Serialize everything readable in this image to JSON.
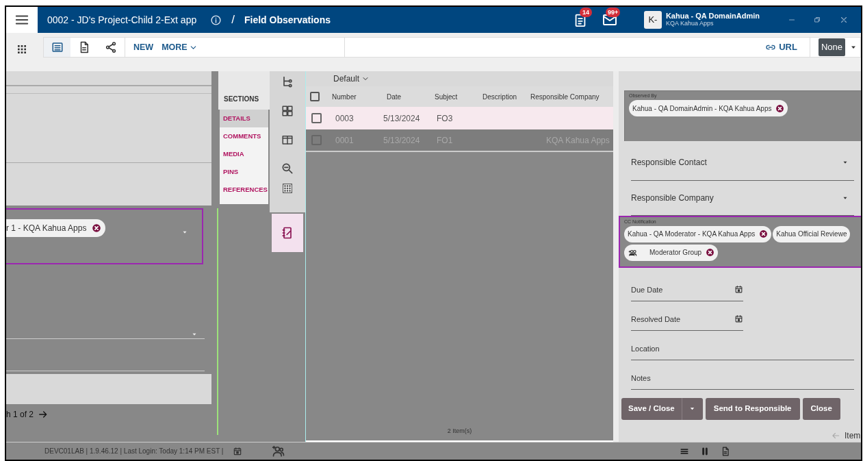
{
  "header": {
    "title": "0002 - JD's Project-Child 2-Ext app",
    "separator": "/",
    "page": "Field Observations",
    "tasks_badge": "14",
    "mail_badge": "99+",
    "avatar": "K-",
    "user_name": "Kahua - QA DomainAdmin",
    "user_org": "KQA Kahua Apps"
  },
  "toolbar": {
    "views": [
      {
        "kind": "list",
        "selected": true
      },
      {
        "kind": "document",
        "selected": false
      },
      {
        "kind": "share",
        "selected": false
      }
    ],
    "actions": [
      "NEW",
      "MORE"
    ],
    "url_label": "URL",
    "select_value": "None"
  },
  "left_panel": {
    "chip": "r 1 - KQA Kahua Apps",
    "pager": "h 1 of 2"
  },
  "sections": {
    "title": "SECTIONS",
    "items": [
      {
        "label": "DETAILS",
        "selected": true
      },
      {
        "label": "COMMENTS",
        "selected": false
      },
      {
        "label": "MEDIA",
        "selected": false
      },
      {
        "label": "PINS",
        "selected": false
      },
      {
        "label": "REFERENCES",
        "selected": false
      }
    ]
  },
  "list": {
    "view": "Default",
    "columns": [
      "Number",
      "Date",
      "Subject",
      "Description",
      "Responsible Company"
    ],
    "rows": [
      {
        "number": "0003",
        "date": "5/13/2024",
        "subject": "FO3",
        "company": "",
        "selected": true
      },
      {
        "number": "0001",
        "date": "5/13/2024",
        "subject": "FO1",
        "company": "KQA Kahua Apps",
        "selected": false
      }
    ],
    "footer": "2 Item(s)",
    "all_selected": false
  },
  "form": {
    "fields": [
      {
        "kind": "chips",
        "label": "Observed By",
        "highlighted": false,
        "chips": [
          {
            "kind": "person",
            "label": "Kahua - QA DomainAdmin - KQA Kahua Apps",
            "removable": true
          }
        ]
      },
      {
        "kind": "select",
        "label": "Responsible Contact"
      },
      {
        "kind": "select",
        "label": "Responsible Company"
      },
      {
        "kind": "chips",
        "label": "CC Notification",
        "highlighted": true,
        "chips": [
          {
            "kind": "person",
            "label": "Kahua - QA Moderator - KQA Kahua Apps",
            "removable": true
          },
          {
            "kind": "person",
            "label": "Kahua Official Reviewe",
            "removable": false
          },
          {
            "kind": "group",
            "label": "Moderator Group",
            "removable": true
          }
        ]
      },
      {
        "kind": "date",
        "label": "Due Date"
      },
      {
        "kind": "date",
        "label": "Resolved Date"
      },
      {
        "kind": "text",
        "label": "Location"
      },
      {
        "kind": "text",
        "label": "Notes"
      }
    ],
    "buttons": [
      {
        "label": "Save / Close",
        "kind": "split"
      },
      {
        "label": "Send to Responsible",
        "kind": "plain"
      },
      {
        "label": "Close",
        "kind": "plain"
      }
    ],
    "pager": "Item"
  },
  "status_bar": {
    "text": "DEVC01LAB | 1.9.46.12 | Last Login: Today 1:14 PM EST |"
  }
}
